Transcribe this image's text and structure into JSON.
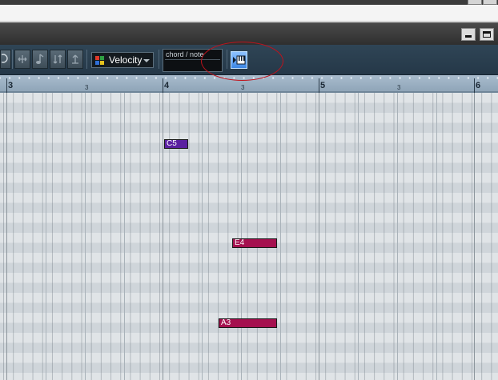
{
  "toolbar": {
    "insert_velocity": {
      "label": "Velocity",
      "icon": "color-grid-icon"
    },
    "chord_display": {
      "label": "chord / note",
      "value": ""
    },
    "step_input_button": {
      "icon": "keyboard-step-input-icon"
    }
  },
  "ruler": {
    "bars": [
      "3",
      "4",
      "5",
      "6"
    ],
    "beats": [
      "3",
      "3",
      "3"
    ]
  },
  "notes": [
    {
      "pitch": "C5",
      "color": "#5a1fa0"
    },
    {
      "pitch": "E4",
      "color": "#a5104f"
    },
    {
      "pitch": "A3",
      "color": "#a5104f"
    }
  ],
  "annotation": {
    "color": "#c0121b"
  }
}
